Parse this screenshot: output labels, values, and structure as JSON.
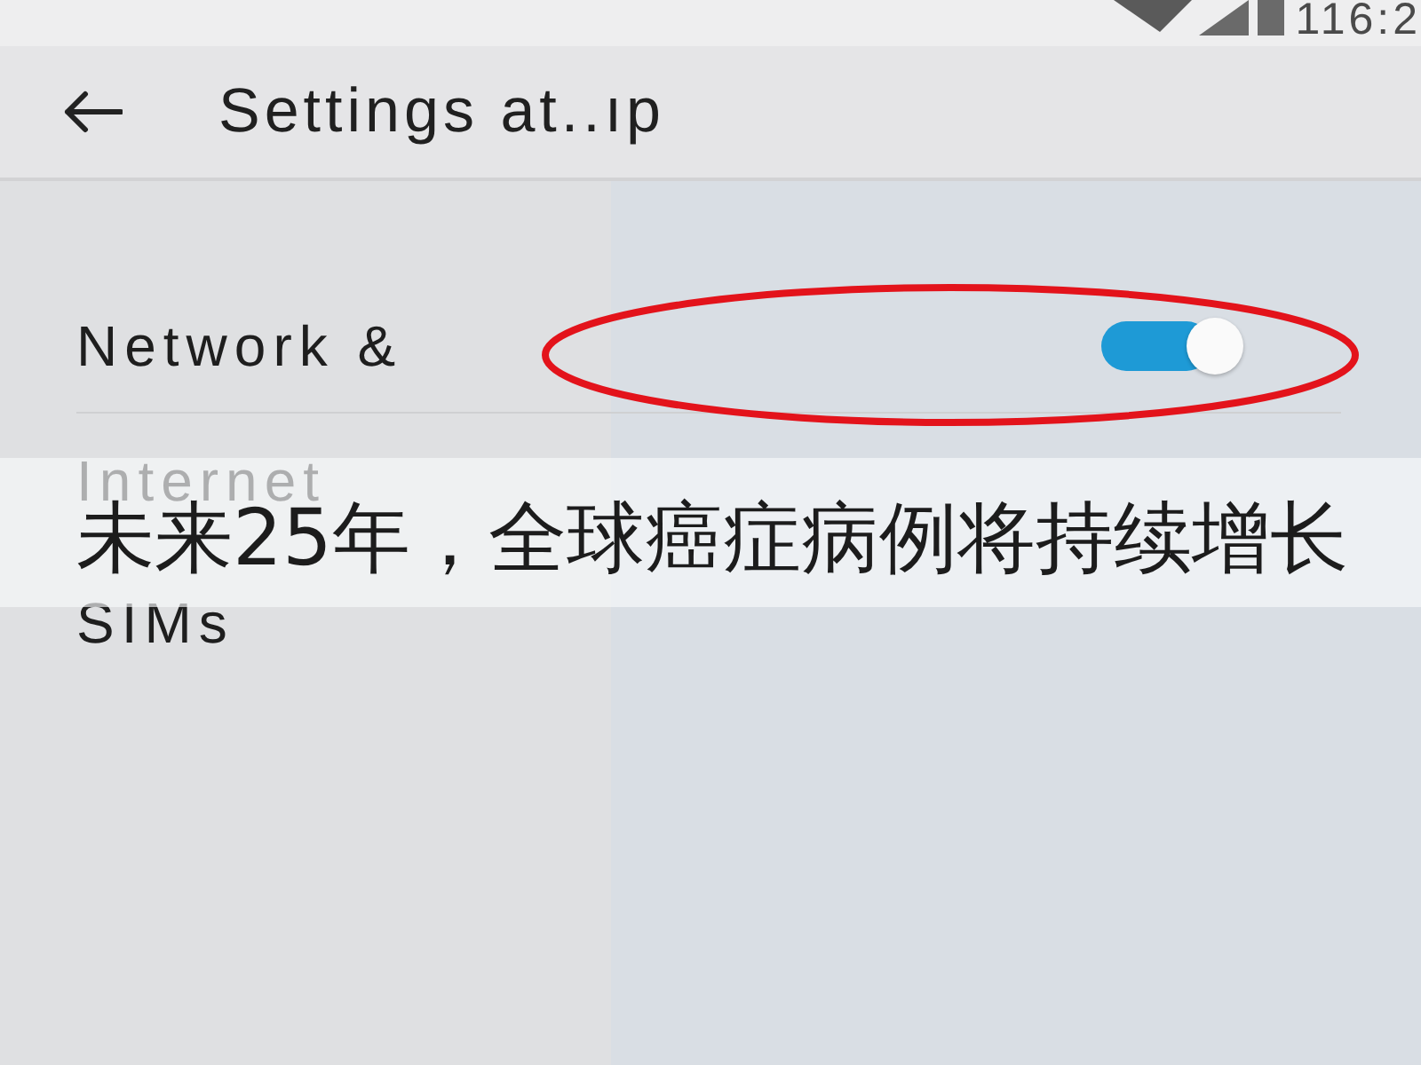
{
  "status_bar": {
    "time": "116:2"
  },
  "header": {
    "title": "Settings at..ıp"
  },
  "items": [
    {
      "label": "Network &",
      "kind": "toggle",
      "on": true,
      "circled": true
    },
    {
      "label": "Internet",
      "kind": "plain"
    },
    {
      "label": "SIMs",
      "kind": "plain"
    }
  ],
  "caption": {
    "text": "未来25年，全球癌症病例将持续增长"
  }
}
